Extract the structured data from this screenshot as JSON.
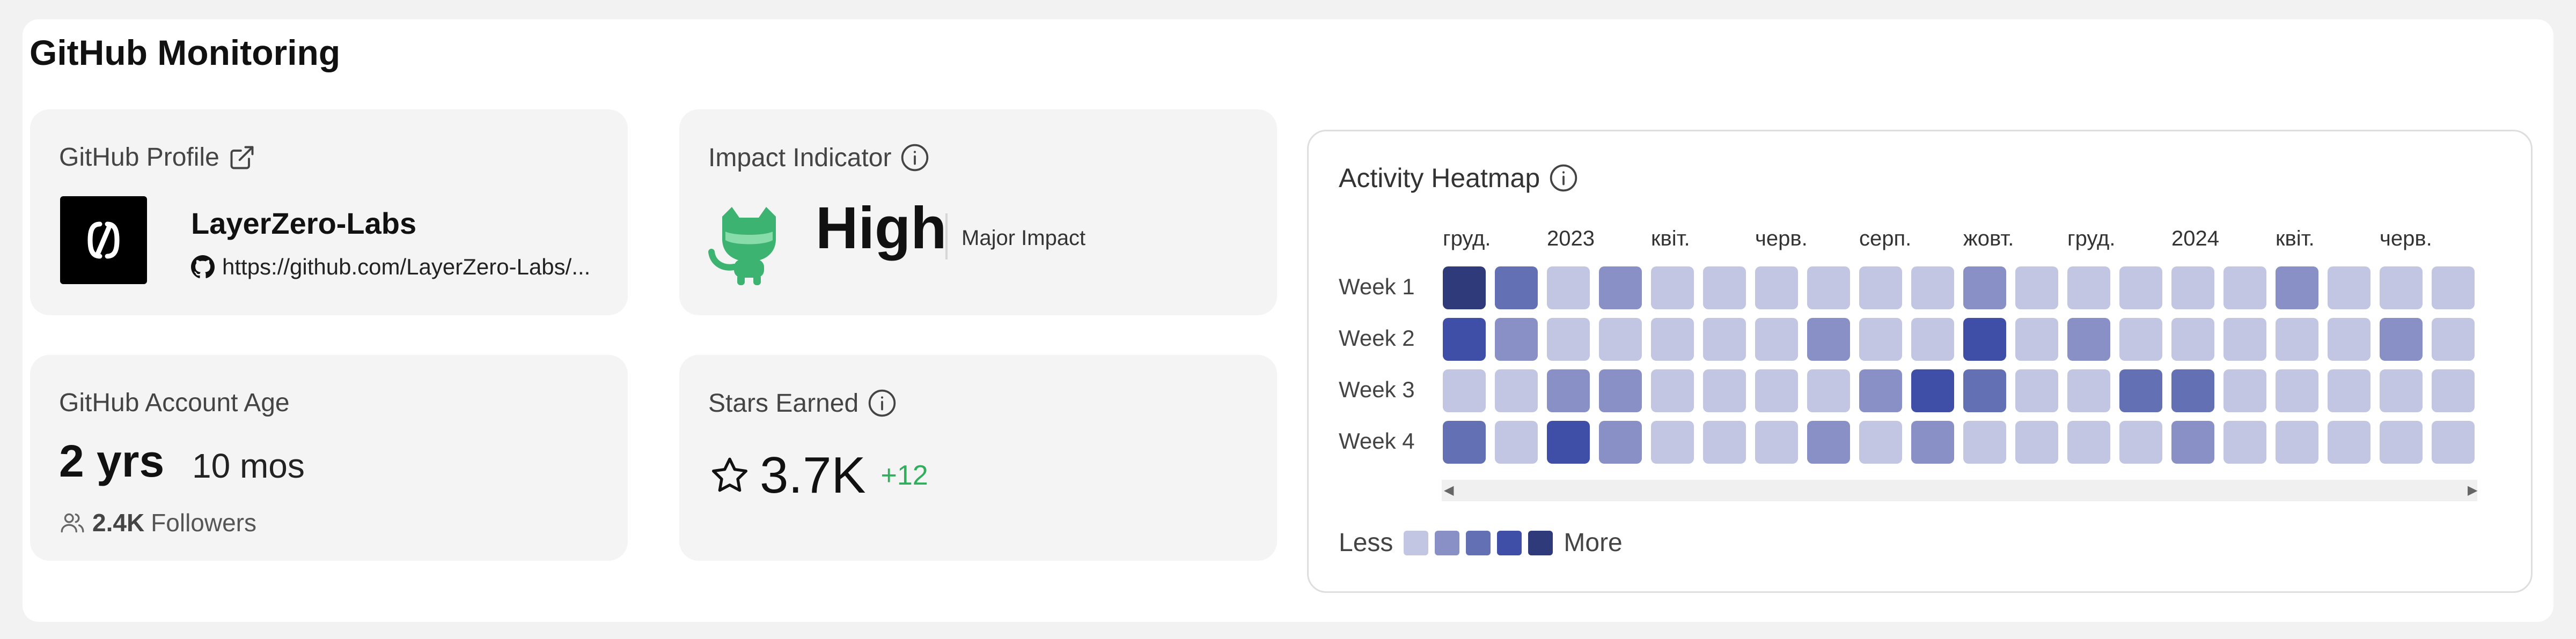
{
  "title": "GitHub Monitoring",
  "profile": {
    "label": "GitHub Profile",
    "org_name": "LayerZero-Labs",
    "url": "https://github.com/LayerZero-Labs/..."
  },
  "impact": {
    "label": "Impact Indicator",
    "value": "High",
    "description": "Major Impact"
  },
  "age": {
    "label": "GitHub Account Age",
    "years": "2 yrs",
    "months": "10 mos",
    "followers_count": "2.4K",
    "followers_label": "Followers"
  },
  "stars": {
    "label": "Stars Earned",
    "value": "3.7K",
    "delta": "+12"
  },
  "heatmap": {
    "label": "Activity Heatmap",
    "months": [
      "груд.",
      "2023",
      "квіт.",
      "черв.",
      "серп.",
      "жовт.",
      "груд.",
      "2024",
      "квіт.",
      "черв."
    ],
    "weeks": [
      "Week 1",
      "Week 2",
      "Week 3",
      "Week 4"
    ],
    "levels_legend": {
      "less": "Less",
      "more": "More"
    },
    "level_colors": [
      "#c3c6e2",
      "#8890c6",
      "#6370b4",
      "#3f4ea6",
      "#2e3a7a"
    ],
    "levels": [
      [
        4,
        2,
        0,
        1,
        0,
        0,
        0,
        0,
        0,
        0,
        1,
        0,
        0,
        0,
        0,
        0,
        1,
        0,
        0,
        0
      ],
      [
        3,
        1,
        0,
        0,
        0,
        0,
        0,
        1,
        0,
        0,
        3,
        0,
        1,
        0,
        0,
        0,
        0,
        0,
        1,
        0
      ],
      [
        0,
        0,
        1,
        1,
        0,
        0,
        0,
        0,
        1,
        3,
        2,
        0,
        0,
        2,
        2,
        0,
        0,
        0,
        0,
        0
      ],
      [
        2,
        0,
        3,
        1,
        0,
        0,
        0,
        1,
        0,
        1,
        0,
        0,
        0,
        0,
        1,
        0,
        0,
        0,
        0,
        0
      ]
    ]
  },
  "colors": {
    "accent_green": "#2fae5b",
    "background": "#f2f2f2",
    "card": "#f4f4f5"
  },
  "icons": {
    "external_link": "external-link-icon",
    "info": "info-icon",
    "github": "github-icon",
    "users": "users-icon",
    "star": "star-icon"
  }
}
